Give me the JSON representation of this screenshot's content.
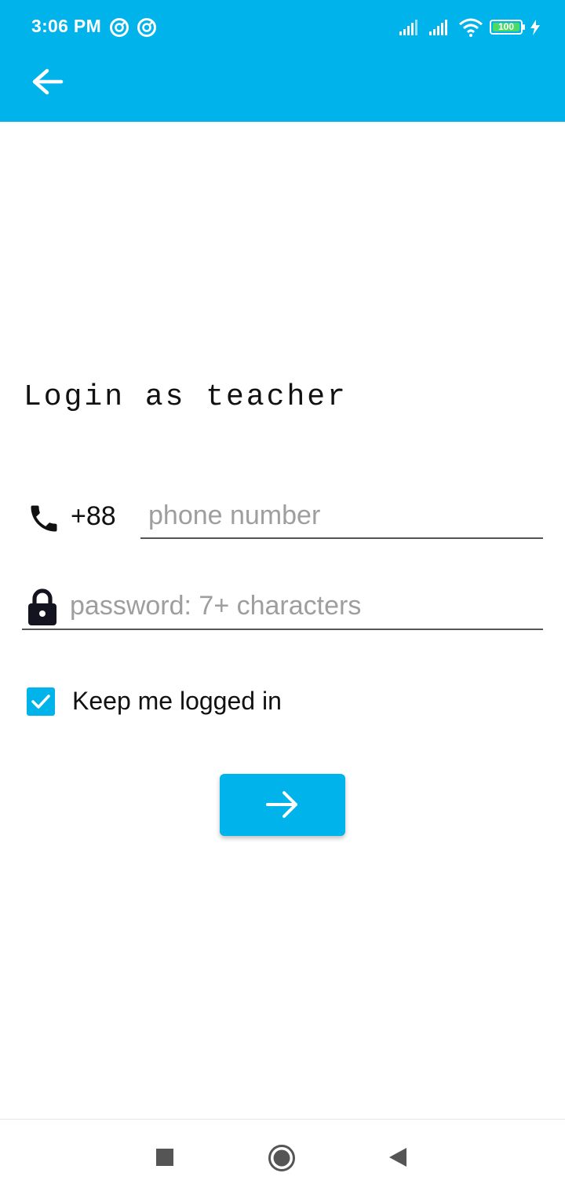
{
  "status_bar": {
    "time": "3:06 PM",
    "battery": "100"
  },
  "login": {
    "title": "Login as teacher",
    "country_code": "+88",
    "phone_placeholder": "phone number",
    "password_placeholder": "password: 7+ characters",
    "keep_logged_in_label": "Keep me logged in",
    "keep_logged_in_checked": true
  },
  "icons": {
    "back": "arrow-left-icon",
    "phone": "phone-icon",
    "password": "lock-icon",
    "submit": "arrow-right-icon"
  },
  "colors": {
    "accent": "#00b3ea",
    "battery": "#4cd964"
  }
}
